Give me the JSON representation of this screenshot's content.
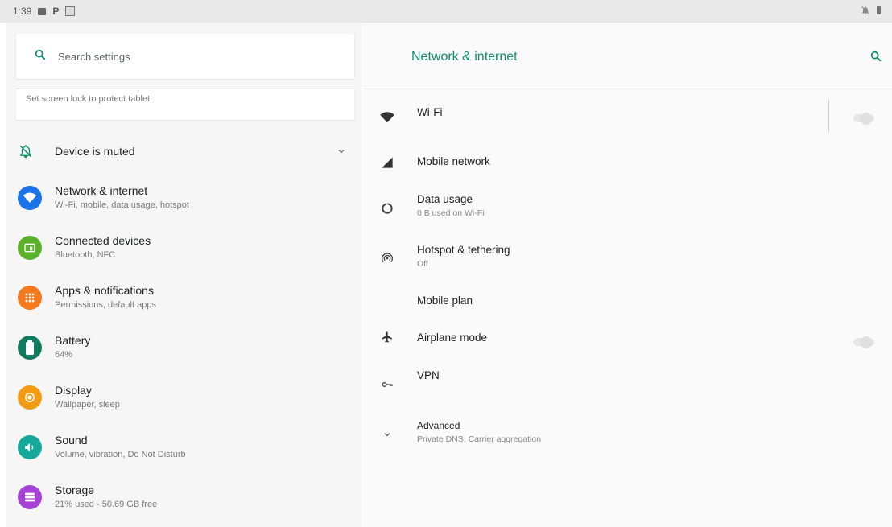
{
  "status_bar": {
    "time": "1:39"
  },
  "search": {
    "placeholder": "Search settings"
  },
  "lock_hint": "Set screen lock to protect tablet",
  "muted": {
    "label": "Device is muted"
  },
  "left_items": [
    {
      "title": "Network & internet",
      "subtitle": "Wi-Fi, mobile, data usage, hotspot",
      "color": "#1a73e8",
      "icon": "wifi-icon"
    },
    {
      "title": "Connected devices",
      "subtitle": "Bluetooth, NFC",
      "color": "#5bb22a",
      "icon": "devices-icon"
    },
    {
      "title": "Apps & notifications",
      "subtitle": "Permissions, default apps",
      "color": "#f47a1e",
      "icon": "apps-icon"
    },
    {
      "title": "Battery",
      "subtitle": "64%",
      "color": "#127a5f",
      "icon": "battery-icon"
    },
    {
      "title": "Display",
      "subtitle": "Wallpaper, sleep",
      "color": "#f39c12",
      "icon": "brightness-icon"
    },
    {
      "title": "Sound",
      "subtitle": "Volume, vibration, Do Not Disturb",
      "color": "#14a89b",
      "icon": "volume-icon"
    },
    {
      "title": "Storage",
      "subtitle": "21% used - 50.69 GB free",
      "color": "#a642d6",
      "icon": "storage-icon"
    }
  ],
  "right_panel": {
    "title": "Network & internet",
    "accent": "#138a72",
    "items": [
      {
        "title": "Wi-Fi",
        "subtitle": "",
        "icon": "wifi-icon"
      },
      {
        "title": "Mobile network",
        "subtitle": "",
        "icon": "signal-icon"
      },
      {
        "title": "Data usage",
        "subtitle": "0 B used on Wi-Fi",
        "icon": "data-usage-icon"
      },
      {
        "title": "Hotspot & tethering",
        "subtitle": "Off",
        "icon": "hotspot-icon"
      },
      {
        "title": "Mobile plan",
        "subtitle": "",
        "icon": ""
      },
      {
        "title": "Airplane mode",
        "subtitle": "",
        "icon": "airplane-icon"
      },
      {
        "title": "VPN",
        "subtitle": "",
        "icon": "vpn-key-icon"
      },
      {
        "title": "Advanced",
        "subtitle": "Private DNS, Carrier aggregation",
        "icon": "chevron-down-icon"
      }
    ],
    "wifi_enabled": false,
    "airplane_enabled": false
  }
}
